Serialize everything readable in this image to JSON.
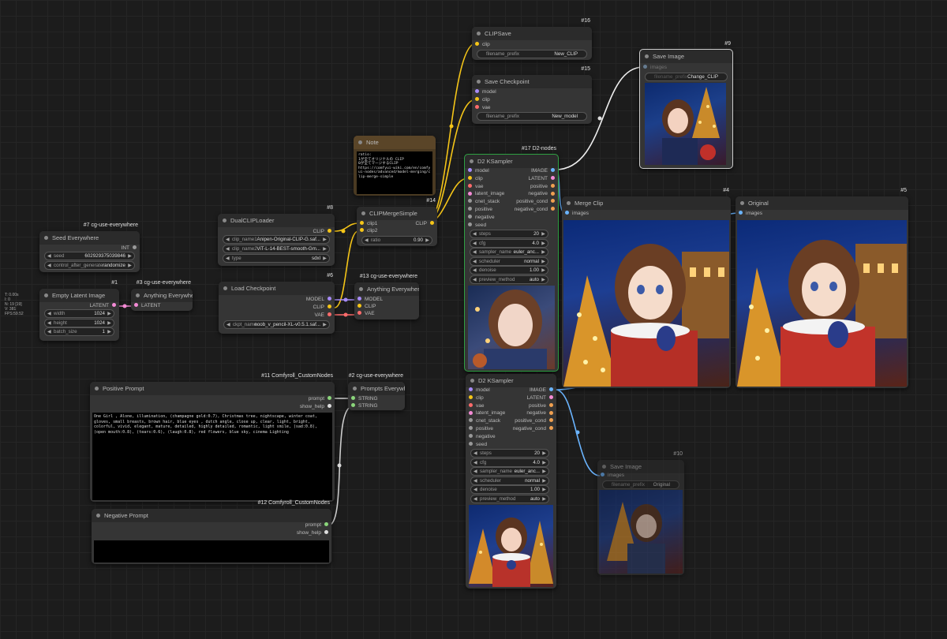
{
  "stats": [
    "T: 0.00s",
    "I: 0",
    "N: 19 [19]",
    "V: 381",
    "FPS:59.52"
  ],
  "nodes": {
    "clipsave": {
      "badge": "#16",
      "title": "CLIPSave",
      "in_clip": "clip",
      "w_label": "filename_prefix",
      "w_value": "New_CLIP"
    },
    "savecheckpoint": {
      "badge": "#15",
      "title": "Save Checkpoint",
      "in_model": "model",
      "in_clip": "clip",
      "in_vae": "vae",
      "w_label": "filename_prefix",
      "w_value": "New_model"
    },
    "saveimage9": {
      "badge": "#9",
      "title": "Save Image",
      "in_images": "images",
      "w_label": "filename_prefix",
      "w_value": "Change_CLIP"
    },
    "note": {
      "title": "Note",
      "lines": [
        "ratio:",
        "",
        "1が全てオリジナルの CLIP",
        "",
        "0が全てマージするCLIP",
        "",
        "https://comfyui-wiki.com/en/comfyui-nodes/advanced/model-merging/clip-merge-simple"
      ]
    },
    "ksampler17": {
      "badge": "#17 D2-nodes",
      "title": "D2 KSampler",
      "inputs": [
        "model",
        "clip",
        "vae",
        "latent_image",
        "cnet_stack",
        "positive",
        "negative",
        "seed"
      ],
      "outputs": [
        "IMAGE",
        "LATENT",
        "positive",
        "negative",
        "positive_cond",
        "negative_cond"
      ],
      "widgets": [
        [
          "steps",
          "20"
        ],
        [
          "cfg",
          "4.0"
        ],
        [
          "sampler_name",
          "euler_anc..."
        ],
        [
          "scheduler",
          "normal"
        ],
        [
          "denoise",
          "1.00"
        ],
        [
          "preview_method",
          "auto"
        ]
      ]
    },
    "ksampler2": {
      "title": "D2 KSampler",
      "inputs": [
        "model",
        "clip",
        "vae",
        "latent_image",
        "cnet_stack",
        "positive",
        "negative",
        "seed"
      ],
      "outputs": [
        "IMAGE",
        "LATENT",
        "positive",
        "negative",
        "positive_cond",
        "negative_cond"
      ],
      "widgets": [
        [
          "steps",
          "20"
        ],
        [
          "cfg",
          "4.0"
        ],
        [
          "sampler_name",
          "euler_anc..."
        ],
        [
          "scheduler",
          "normal"
        ],
        [
          "denoise",
          "1.00"
        ],
        [
          "preview_method",
          "auto"
        ]
      ]
    },
    "mergeclip": {
      "badge": "#4",
      "title": "Merge Clip",
      "in_images": "images"
    },
    "original": {
      "badge": "#5",
      "title": "Original",
      "in_images": "images"
    },
    "saveimage10": {
      "badge": "#10",
      "title": "Save Image",
      "in_images": "images",
      "w_label": "filename_prefix",
      "w_value": "Original"
    },
    "dualclip": {
      "badge": "#8",
      "title": "DualCLIPLoader",
      "out_clip": "CLIP",
      "widgets": [
        [
          "clip_name1",
          "Anipen-Original-CLIP-G.saf..."
        ],
        [
          "clip_name2",
          "ViT-L-14-BEST-smooth-Gm..."
        ],
        [
          "type",
          "sdxl"
        ]
      ]
    },
    "clipmerge": {
      "badge": "#14",
      "title": "CLIPMergeSimple",
      "in1": "clip1",
      "in2": "clip2",
      "out": "CLIP",
      "w_label": "ratio",
      "w_value": "0.90"
    },
    "seed": {
      "badge": "#7 cg-use-everywhere",
      "title": "Seed Everywhere",
      "out": "INT",
      "widgets": [
        [
          "seed",
          "602929375039846"
        ],
        [
          "control_after_generate",
          "randomize"
        ]
      ]
    },
    "emptylatent": {
      "badge": "#1",
      "title": "Empty Latent Image",
      "out": "LATENT",
      "widgets": [
        [
          "width",
          "1024"
        ],
        [
          "height",
          "1024"
        ],
        [
          "batch_size",
          "1"
        ]
      ]
    },
    "anything3": {
      "badge": "#3 cg-use-everywhere",
      "title": "Anything Everywhere",
      "in": "LATENT"
    },
    "loadckpt": {
      "badge": "#6",
      "title": "Load Checkpoint",
      "outputs": [
        "MODEL",
        "CLIP",
        "VAE"
      ],
      "w_label": "ckpt_name",
      "w_value": "noob_v_pencil-XL-v0.5.1.saf..."
    },
    "anything13": {
      "badge": "#13 cg-use-everywhere",
      "title": "Anything Everywhere3",
      "inputs": [
        "MODEL",
        "CLIP",
        "VAE"
      ]
    },
    "positive": {
      "badge": "#11 Comfyroll_CustomNodes",
      "title": "Positive Prompt",
      "outputs": [
        "prompt",
        "show_help"
      ],
      "text": "One Girl , Alone, illumination, (champagne gold:0.7), Christmas tree, nightscape, winter coat, gloves, small breasts, brown hair, blue eyes , dutch angle, close up, clear, light, bright, colorful, vivid, elegant, mature, detailed, highly detailed, romantic, light smile, (sad:0.8), (open mouth:0.8), (tears:0.6), (laugh:0.8), red flowers, blue sky,  cinema Lighting"
    },
    "prompts2": {
      "badge": "#2 cg-use-everywhere",
      "title": "Prompts Everywhere",
      "inputs": [
        "STRING",
        "STRING"
      ]
    },
    "negative": {
      "badge": "#12 Comfyroll_CustomNodes",
      "title": "Negative Prompt",
      "outputs": [
        "prompt",
        "show_help"
      ],
      "text": ""
    }
  }
}
